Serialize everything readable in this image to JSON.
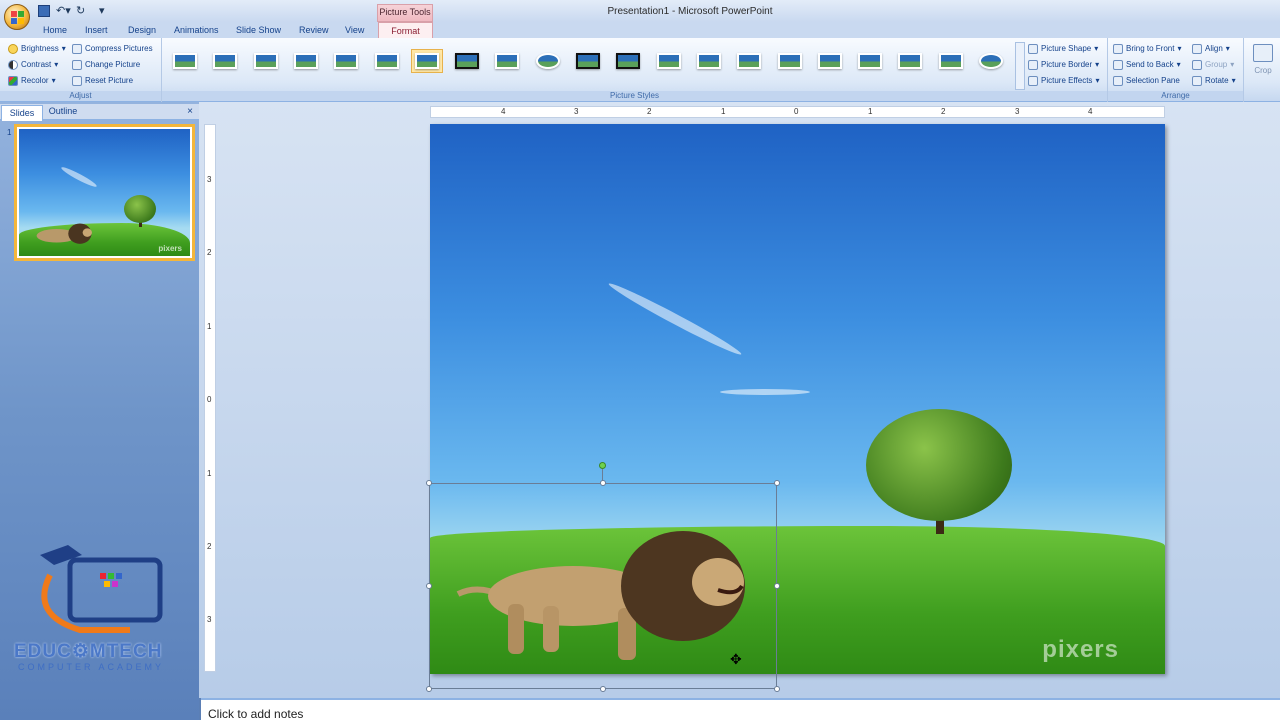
{
  "window": {
    "app_title": "Presentation1 - Microsoft PowerPoint",
    "context_tab_group": "Picture Tools"
  },
  "tabs": [
    "Home",
    "Insert",
    "Design",
    "Animations",
    "Slide Show",
    "Review",
    "View",
    "Format"
  ],
  "active_tab": "Format",
  "ribbon": {
    "adjust": {
      "label": "Adjust",
      "brightness": "Brightness",
      "contrast": "Contrast",
      "recolor": "Recolor",
      "compress": "Compress Pictures",
      "change": "Change Picture",
      "reset": "Reset Picture"
    },
    "picture_styles": {
      "label": "Picture Styles",
      "shape": "Picture Shape",
      "border": "Picture Border",
      "effects": "Picture Effects",
      "selected_index": 6
    },
    "arrange": {
      "label": "Arrange",
      "bring_front": "Bring to Front",
      "send_back": "Send to Back",
      "selection_pane": "Selection Pane",
      "align": "Align",
      "group": "Group",
      "rotate": "Rotate"
    },
    "crop": "Crop"
  },
  "slides_pane": {
    "tab_slides": "Slides",
    "tab_outline": "Outline",
    "close": "×",
    "slide_number": "1",
    "thumb_watermark": "pixers"
  },
  "ruler": {
    "h_labels": [
      "4",
      "3",
      "2",
      "1",
      "0",
      "1",
      "2",
      "3",
      "4"
    ],
    "v_labels": [
      "3",
      "2",
      "1",
      "0",
      "1",
      "2",
      "3"
    ]
  },
  "slide": {
    "watermark": "pixers"
  },
  "notes": {
    "placeholder": "Click to add notes"
  },
  "branding": {
    "name": "EDUC⚙MTECH",
    "tagline": "COMPUTER ACADEMY"
  },
  "colors": {
    "ribbon_bg": "#dce8f7",
    "context_tab": "#f0b9c1",
    "selection_handle_rotate": "#6fd14f"
  }
}
